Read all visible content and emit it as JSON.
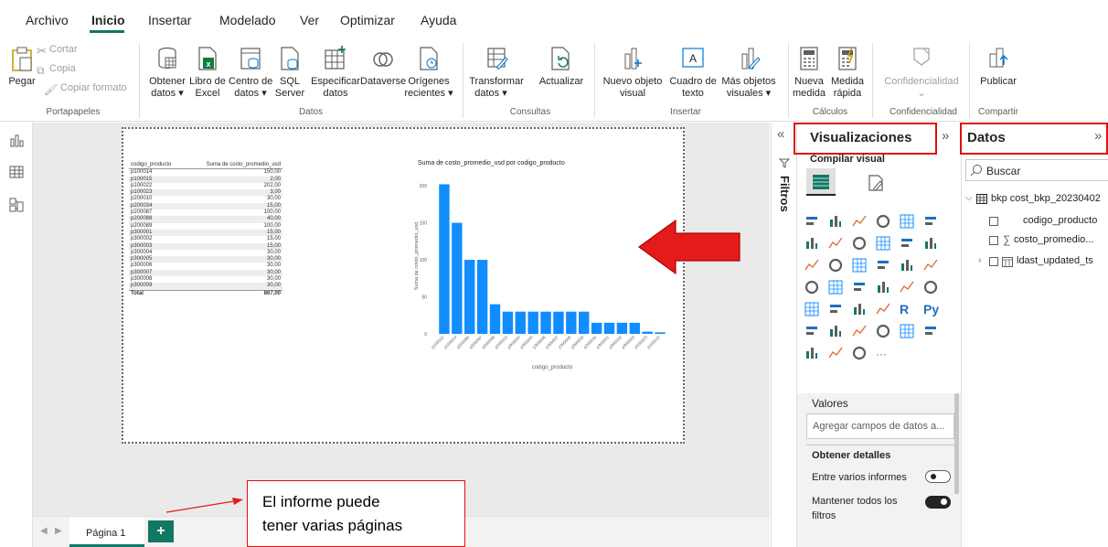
{
  "menu": {
    "items": [
      "Archivo",
      "Inicio",
      "Insertar",
      "Modelado",
      "Ver",
      "Optimizar",
      "Ayuda"
    ]
  },
  "ribbon": {
    "portapapeles": {
      "pegar": "Pegar",
      "cortar": "Cortar",
      "copia": "Copia",
      "copiar_formato": "Copiar formato",
      "group": "Portapapeles"
    },
    "datos": {
      "obtener_1": "Obtener",
      "obtener_2": "datos ▾",
      "libro_1": "Libro de",
      "libro_2": "Excel",
      "centro_1": "Centro de",
      "centro_2": "datos ▾",
      "sql_1": "SQL",
      "sql_2": "Server",
      "especificar_1": "Especificar",
      "especificar_2": "datos",
      "dataverse": "Dataverse",
      "origenes_1": "Orígenes",
      "origenes_2": "recientes ▾",
      "group": "Datos"
    },
    "consultas": {
      "transformar_1": "Transformar",
      "transformar_2": "datos ▾",
      "actualizar": "Actualizar",
      "group": "Consultas"
    },
    "insertar": {
      "nuevo_1": "Nuevo objeto",
      "nuevo_2": "visual",
      "cuadro_1": "Cuadro de",
      "cuadro_2": "texto",
      "mas_1": "Más objetos",
      "mas_2": "visuales ▾",
      "group": "Insertar"
    },
    "calculos": {
      "nueva_1": "Nueva",
      "nueva_2": "medida",
      "medida_1": "Medida",
      "medida_2": "rápida",
      "group": "Cálculos"
    },
    "confidencialidad": {
      "label": "Confidencialidad",
      "chev": "⌄",
      "group": "Confidencialidad"
    },
    "compartir": {
      "publicar": "Publicar",
      "group": "Compartir"
    }
  },
  "table_visual": {
    "headers": [
      "codigo_producto",
      "Suma de costo_promedio_usd"
    ],
    "rows": [
      [
        "p100014",
        "150,00"
      ],
      [
        "p100015",
        "2,00"
      ],
      [
        "p100022",
        "202,00"
      ],
      [
        "p100023",
        "3,00"
      ],
      [
        "p200010",
        "30,00"
      ],
      [
        "p200034",
        "15,00"
      ],
      [
        "p200087",
        "100,00"
      ],
      [
        "p200088",
        "40,00"
      ],
      [
        "p200089",
        "100,00"
      ],
      [
        "p300001",
        "15,00"
      ],
      [
        "p300002",
        "15,00"
      ],
      [
        "p300003",
        "15,00"
      ],
      [
        "p300004",
        "30,00"
      ],
      [
        "p300005",
        "30,00"
      ],
      [
        "p300006",
        "30,00"
      ],
      [
        "p300007",
        "30,00"
      ],
      [
        "p300008",
        "30,00"
      ],
      [
        "p300009",
        "30,00"
      ]
    ],
    "total_label": "Total",
    "total_value": "867,00"
  },
  "chart_data": {
    "type": "bar",
    "title": "Suma de costo_promedio_usd por codigo_producto",
    "xlabel": "codigo_producto",
    "ylabel": "Suma de costo_promedio_usd",
    "ylim": [
      0,
      210
    ],
    "yticks": [
      0,
      50,
      100,
      150,
      200
    ],
    "categories": [
      "p100022",
      "p100014",
      "p200089",
      "p200087",
      "p200088",
      "p200010",
      "p300004",
      "p300005",
      "p300006",
      "p300007",
      "p300008",
      "p300009",
      "p200034",
      "p300001",
      "p300002",
      "p300003",
      "p100023",
      "p100015"
    ],
    "values": [
      202,
      150,
      100,
      100,
      40,
      30,
      30,
      30,
      30,
      30,
      30,
      30,
      15,
      15,
      15,
      15,
      3,
      2
    ],
    "bar_color": "#118dff"
  },
  "annotation": {
    "line1": "El informe puede",
    "line2": "tener varias páginas"
  },
  "tabs": {
    "page1": "Página 1",
    "add": "+"
  },
  "filters": {
    "label": "Filtros",
    "collapse": "«"
  },
  "visualizations": {
    "title": "Visualizaciones",
    "expand": "»",
    "subtitle": "Compilar visual",
    "valores": "Valores",
    "agregar": "Agregar campos de datos a...",
    "obtener_detalles": "Obtener detalles",
    "entre_varios": "Entre varios informes",
    "mantener": "Mantener todos los",
    "filtros": "filtros",
    "r_label": "R",
    "py_label": "Py",
    "more": "···"
  },
  "data_pane": {
    "title": "Datos",
    "expand": "»",
    "search_placeholder": "Buscar",
    "table_name": "bkp cost_bkp_20230402",
    "fields": [
      "codigo_producto",
      "costo_promedio...",
      "ldast_updated_ts"
    ],
    "sigma": "∑"
  },
  "colors": {
    "accent": "#117865",
    "bar": "#118dff",
    "highlight_red": "#e01010",
    "arrow_red": "#e31b1b"
  }
}
